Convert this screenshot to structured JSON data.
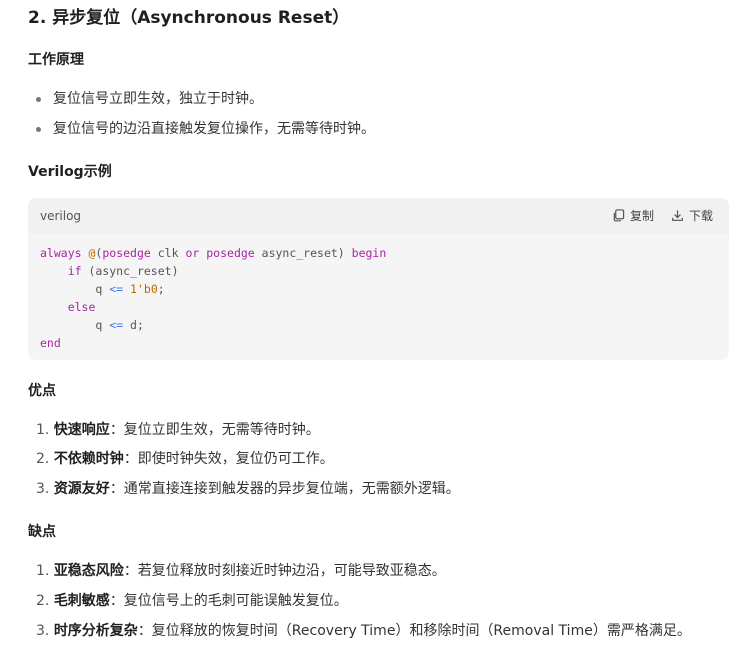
{
  "title": "2. 异步复位（Asynchronous Reset）",
  "principle": {
    "heading": "工作原理",
    "bullets": [
      "复位信号立即生效，独立于时钟。",
      "复位信号的边沿直接触发复位操作，无需等待时钟。"
    ]
  },
  "example": {
    "heading": "Verilog示例",
    "code_block": {
      "language": "verilog",
      "copy_label": "复制",
      "download_label": "下载",
      "lines": {
        "l1_kw": "always",
        "l1_at": "@",
        "l1_a": "(",
        "l1_pos1": "posedge",
        "l1_b": " clk ",
        "l1_or": "or",
        "l1_sp": " ",
        "l1_pos2": "posedge",
        "l1_c": " async_reset) ",
        "l1_begin": "begin",
        "l2_if": "if",
        "l2_rest": " (async_reset)",
        "l3_q": "q ",
        "l3_op": "<=",
        "l3_sp": " ",
        "l3_val": "1'b0",
        "l3_end": ";",
        "l4_else": "else",
        "l5_q": "q ",
        "l5_op": "<=",
        "l5_rest": " d;",
        "l6_end": "end"
      }
    }
  },
  "pros": {
    "heading": "优点",
    "items": [
      {
        "num": "1.",
        "label": "快速响应",
        "text": "：复位立即生效，无需等待时钟。"
      },
      {
        "num": "2.",
        "label": "不依赖时钟",
        "text": "：即使时钟失效，复位仍可工作。"
      },
      {
        "num": "3.",
        "label": "资源友好",
        "text": "：通常直接连接到触发器的异步复位端，无需额外逻辑。"
      }
    ]
  },
  "cons": {
    "heading": "缺点",
    "items": [
      {
        "num": "1.",
        "label": "亚稳态风险",
        "text": "：若复位释放时刻接近时钟边沿，可能导致亚稳态。"
      },
      {
        "num": "2.",
        "label": "毛刺敏感",
        "text": "：复位信号上的毛刺可能误触发复位。"
      },
      {
        "num": "3.",
        "label": "时序分析复杂",
        "text": "：复位释放的恢复时间（Recovery Time）和移除时间（Removal Time）需严格满足。"
      }
    ]
  }
}
